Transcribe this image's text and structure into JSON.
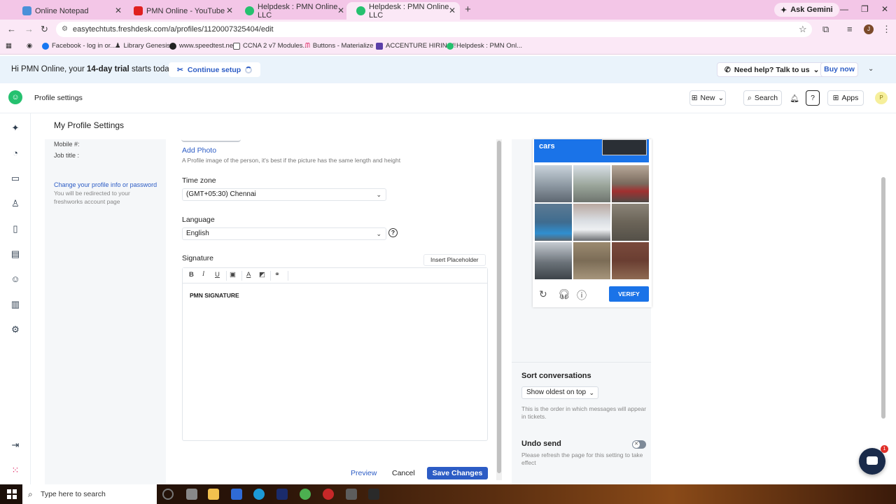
{
  "browser": {
    "tabs": [
      {
        "title": "Online Notepad",
        "favicon_color": "#4a90d9"
      },
      {
        "title": "PMN Online - YouTube",
        "favicon_color": "#e02020"
      },
      {
        "title": "Helpdesk : PMN Online LLC",
        "favicon_color": "#25c16f"
      },
      {
        "title": "Helpdesk : PMN Online LLC",
        "favicon_color": "#25c16f"
      }
    ],
    "gemini_label": "Ask Gemini",
    "url": "easytechtuts.freshdesk.com/a/profiles/1120007325404/edit",
    "bookmarks": [
      "Facebook - log in or...",
      "Library Genesis",
      "www.speedtest.net",
      "CCNA 2 v7 Modules...",
      "Buttons - Materialize",
      "ACCENTURE HIRING!!",
      "Helpdesk : PMN Onl..."
    ]
  },
  "trial": {
    "prefix": "Hi PMN Online, your ",
    "bold": "14-day trial",
    "suffix": " starts today.",
    "continue_label": "Continue setup",
    "help_label": "Need help? Talk to us",
    "buy_label": "Buy now"
  },
  "header": {
    "title": "Profile settings",
    "new_label": "New",
    "search_label": "Search",
    "apps_label": "Apps",
    "avatar_initial": "P"
  },
  "page": {
    "title": "My Profile Settings",
    "left_panel": {
      "mobile_label": "Mobile #:",
      "job_label": "Job title :",
      "change_link": "Change your profile info or password",
      "redirect_note": "You will be redirected to your freshworks account page"
    },
    "form": {
      "add_photo": "Add Photo",
      "photo_hint": "A Profile image of the person, it's best if the picture has the same length and height",
      "timezone_label": "Time zone",
      "timezone_value": "(GMT+05:30) Chennai",
      "language_label": "Language",
      "language_value": "English",
      "signature_label": "Signature",
      "insert_placeholder": "Insert Placeholder",
      "signature_text": "PMN SIGNATURE"
    },
    "actions": {
      "preview": "Preview",
      "cancel": "Cancel",
      "save": "Save Changes"
    },
    "captcha": {
      "header_text": "cars",
      "verify_label": "VERIFY"
    },
    "sort": {
      "label": "Sort conversations",
      "value": "Show oldest on top",
      "help": "This is the order in which messages will appear in tickets."
    },
    "undo": {
      "label": "Undo send",
      "help": "Please refresh the page for this setting to take effect"
    },
    "chat_badge": "1"
  },
  "taskbar": {
    "search_placeholder": "Type here to search"
  },
  "colors": {
    "accent": "#2c5cc5",
    "brand_green": "#25c16f",
    "captcha_blue": "#1a73e8"
  }
}
